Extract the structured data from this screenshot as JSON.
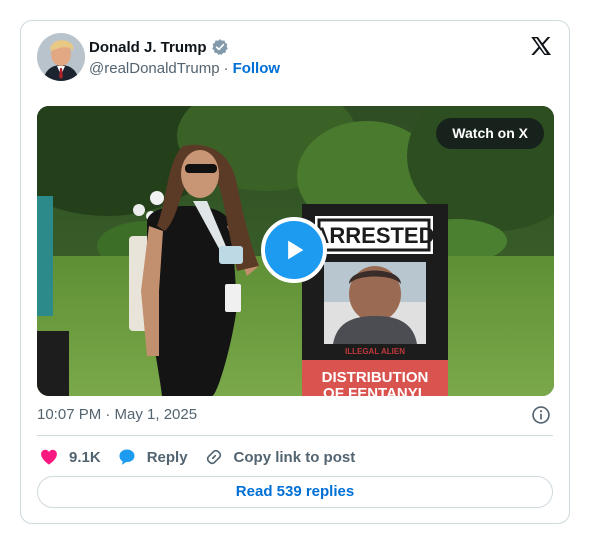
{
  "author": {
    "name": "Donald J. Trump",
    "handle": "@realDonaldTrump",
    "separator": "·",
    "follow_label": "Follow",
    "verified": true
  },
  "media": {
    "watch_label": "Watch on X",
    "sign_header": "ARRESTED",
    "sign_caption": "ILLEGAL ALIEN",
    "sign_line1": "DISTRIBUTION",
    "sign_line2": "OF FENTANYL"
  },
  "meta": {
    "timestamp": "10:07 PM · May 1, 2025"
  },
  "actions": {
    "likes": "9.1K",
    "reply_label": "Reply",
    "copy_label": "Copy link to post"
  },
  "read_replies_label": "Read 539 replies",
  "colors": {
    "link_blue": "#006fd6",
    "play_blue": "#1d9bf0",
    "like_pink": "#f91880",
    "muted": "#536471",
    "border": "#cfd9de"
  },
  "icons": [
    "verified-badge-icon",
    "x-logo-icon",
    "play-icon",
    "info-icon",
    "heart-icon",
    "reply-bubble-icon",
    "link-icon"
  ]
}
